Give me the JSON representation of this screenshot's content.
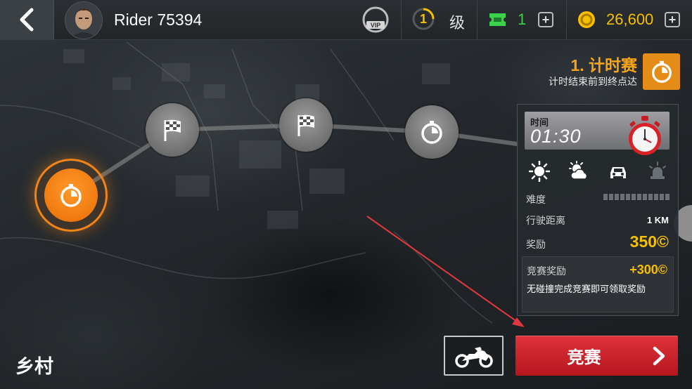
{
  "header": {
    "player_name": "Rider 75394",
    "vip_label": "VIP",
    "level": "1",
    "level_label": "级",
    "tickets": "1",
    "coins": "26,600"
  },
  "event": {
    "title": "1. 计时赛",
    "subtitle": "计时结束前到终点达"
  },
  "panel": {
    "time_label": "时间",
    "time_value": "01:30",
    "conditions": [
      "sunny-icon",
      "partly-cloudy-icon",
      "car-icon",
      "police-siren-icon"
    ],
    "difficulty_label": "难度",
    "difficulty_filled": 0,
    "difficulty_total": 12,
    "distance_label": "行驶距离",
    "distance_value": "1 KM",
    "reward_label": "奖励",
    "reward_value": "350©",
    "bonus_label": "竞赛奖励",
    "bonus_value": "+300©",
    "bonus_desc": "无碰撞完成竞赛即可领取奖励"
  },
  "map": {
    "nodes": [
      "stopwatch-node",
      "checkered-flag-node",
      "checkered-flag-node",
      "stopwatch-node"
    ],
    "region": "乡村"
  },
  "actions": {
    "race_label": "竞赛"
  },
  "colors": {
    "accent_orange": "#f08418",
    "gold": "#f5c000",
    "ticket_green": "#39d24a",
    "race_red": "#d0242c"
  }
}
